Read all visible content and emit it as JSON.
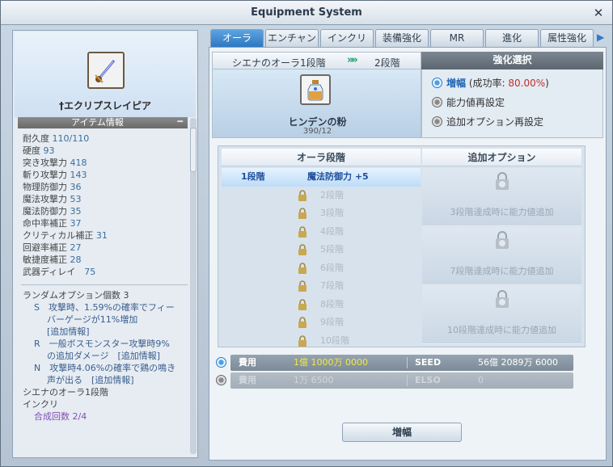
{
  "window": {
    "title": "Equipment System"
  },
  "item": {
    "name": "†エクリプスレイピア",
    "info_header": "アイテム情報",
    "stats": [
      {
        "label": "耐久度",
        "value": "110/110"
      },
      {
        "label": "硬度",
        "value": "93"
      },
      {
        "label": "突き攻撃力",
        "value": "418"
      },
      {
        "label": "斬り攻撃力",
        "value": "143"
      },
      {
        "label": "物理防御力",
        "value": "36"
      },
      {
        "label": "魔法攻撃力",
        "value": "53"
      },
      {
        "label": "魔法防御力",
        "value": "35"
      },
      {
        "label": "命中率補正",
        "value": "37"
      },
      {
        "label": "クリティカル補正",
        "value": "31"
      },
      {
        "label": "回避率補正",
        "value": "27"
      },
      {
        "label": "敏捷度補正",
        "value": "28"
      },
      {
        "label": "武器ディレイ",
        "value": "75"
      }
    ],
    "random_options": {
      "count_line": "ランダムオプション個数 3",
      "lines": [
        "S　攻撃時、1.59%の確率でフィー",
        "バーゲージが11%増加",
        "[追加情報]",
        "R　一般ボスモンスター攻撃時9%",
        "の追加ダメージ　[追加情報]",
        "N　攻撃時4.06%の確率で鶏の鳴き",
        "声が出る　[追加情報]"
      ],
      "aura": "シエナのオーラ1段階",
      "inkuri": "インクリ",
      "synth": "合成回数 2/4"
    }
  },
  "tabs": [
    "オーラ",
    "エンチャント",
    "インクリ",
    "装備強化",
    "MR",
    "進化",
    "属性強化"
  ],
  "upgrade": {
    "current": "シエナのオーラ1段階",
    "arrows": "»»",
    "next": "2段階",
    "material_name": "ヒンデンの粉",
    "material_count": "390/12"
  },
  "selection": {
    "header": "強化選択",
    "options": [
      {
        "label": "増幅",
        "extra_prefix": "(成功率:",
        "extra_value": "80.00%",
        "extra_suffix": ")"
      },
      {
        "label": "能力値再設定"
      },
      {
        "label": "追加オプション再設定"
      }
    ]
  },
  "stages": {
    "col_stage": "オーラ段階",
    "col_option": "追加オプション",
    "active": {
      "stage": "1段階",
      "effect": "魔法防御力 +5"
    },
    "locked": [
      "2段階",
      "3段階",
      "4段階",
      "5段階",
      "6段階",
      "7段階",
      "8段階",
      "9段階",
      "10段階"
    ],
    "options": [
      "3段階達成時に能力値追加",
      "7段階達成時に能力値追加",
      "10段階達成時に能力値追加"
    ]
  },
  "costs": [
    {
      "label": "費用",
      "value": "1億 1000万 0000",
      "label2": "SEED",
      "value2": "56億 2089万 6000",
      "selected": true
    },
    {
      "label": "費用",
      "value": "1万 6500",
      "label2": "ELSO",
      "value2": "0",
      "selected": false
    }
  ],
  "buttons": {
    "upgrade": "増幅"
  }
}
